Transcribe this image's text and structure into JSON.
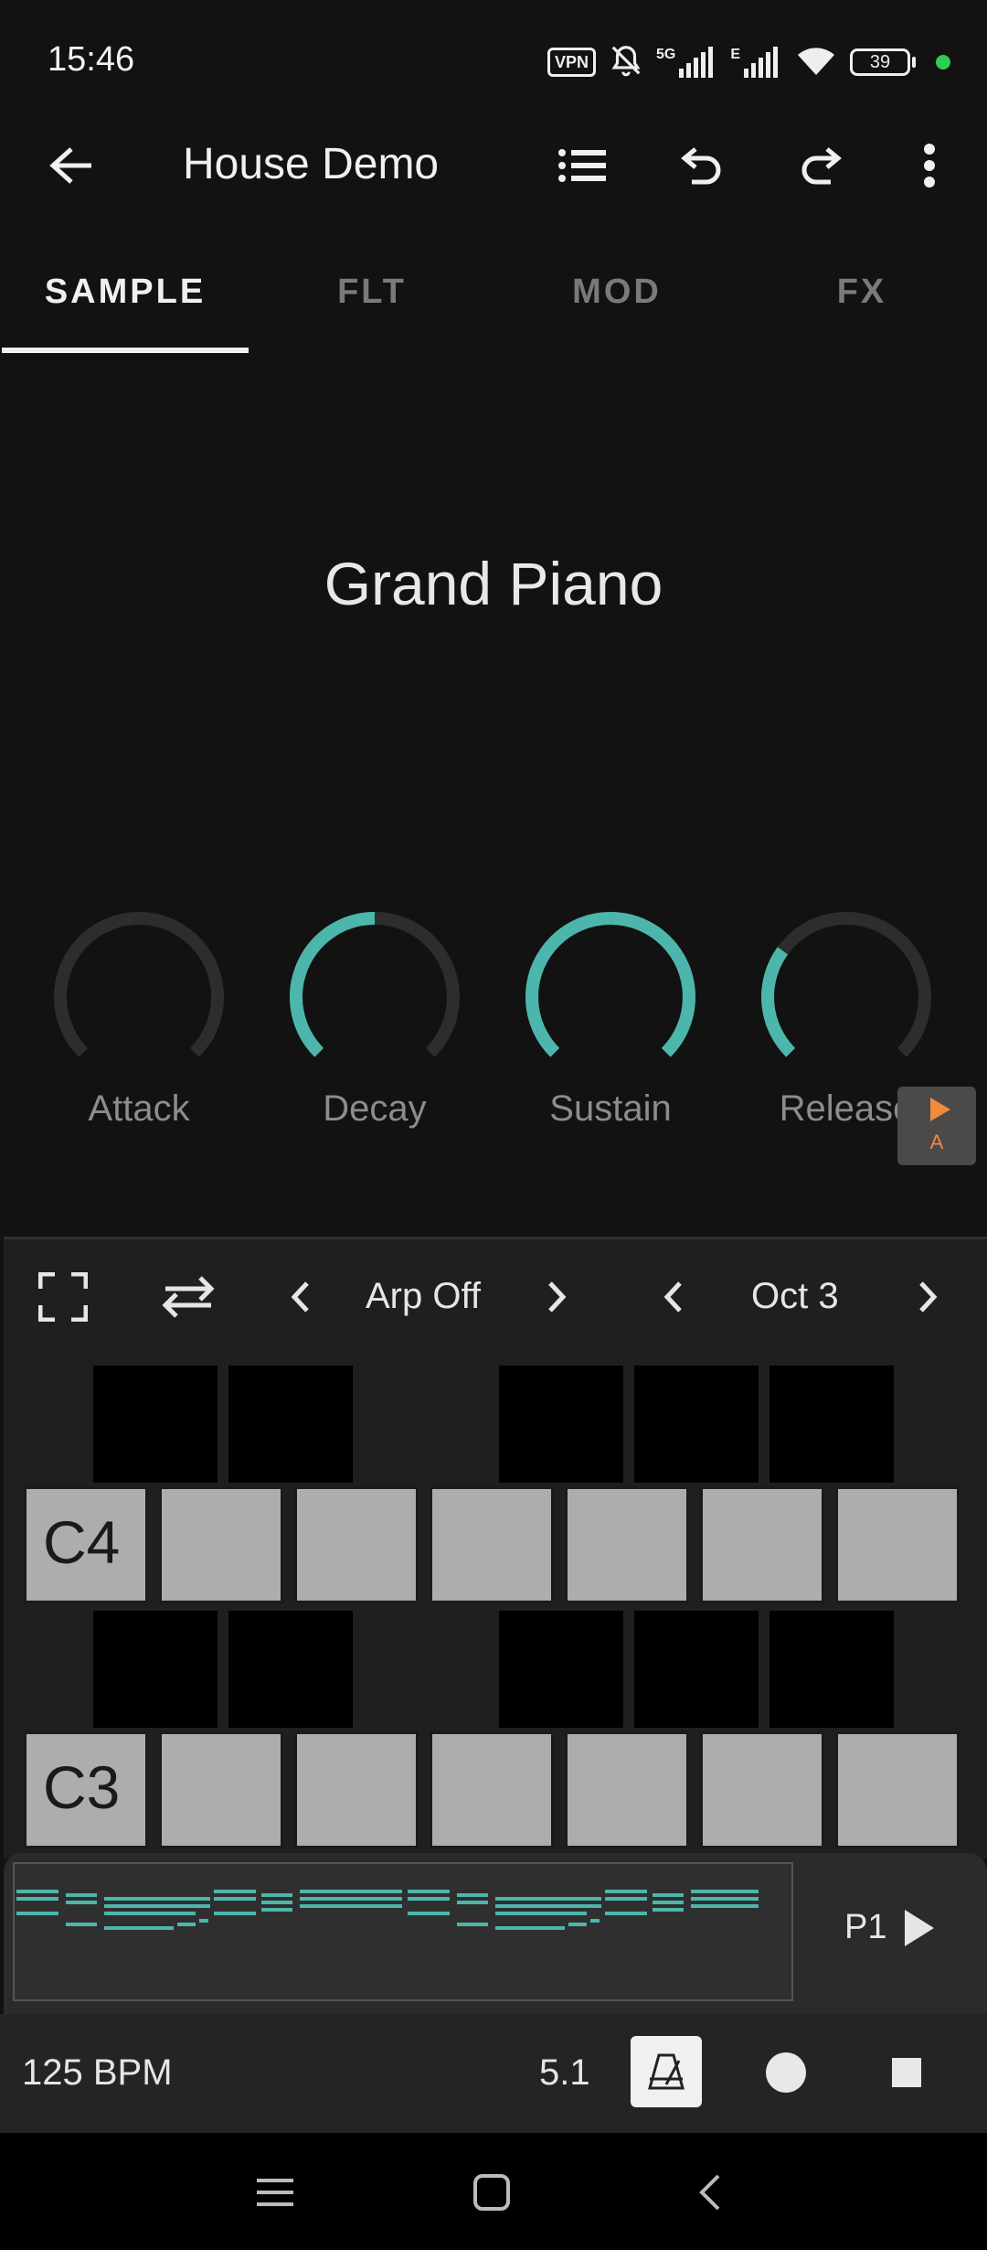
{
  "status": {
    "time": "15:46",
    "vpn": "VPN",
    "network": "5G",
    "network2": "E",
    "battery": "39"
  },
  "app_bar": {
    "title": "House Demo",
    "icons": [
      "back-arrow-icon",
      "list-icon",
      "undo-icon",
      "redo-icon",
      "more-vert-icon"
    ]
  },
  "tabs": [
    {
      "label": "SAMPLE",
      "active": true
    },
    {
      "label": "FLT",
      "active": false
    },
    {
      "label": "MOD",
      "active": false
    },
    {
      "label": "FX",
      "active": false
    }
  ],
  "instrument": {
    "name": "Grand Piano"
  },
  "knobs": [
    {
      "label": "Attack",
      "value": 0.0
    },
    {
      "label": "Decay",
      "value": 0.5
    },
    {
      "label": "Sustain",
      "value": 1.0
    },
    {
      "label": "Release",
      "value": 0.3
    }
  ],
  "accent_color": "#4db6ac",
  "auto_button": {
    "letter": "A",
    "color": "#f08a3c"
  },
  "keyboard": {
    "arp_label": "Arp Off",
    "octave_label": "Oct 3",
    "upper_octave_key": "C4",
    "lower_octave_key": "C3"
  },
  "pattern": {
    "label": "P1"
  },
  "transport": {
    "bpm": "125 BPM",
    "position": "5.1"
  }
}
